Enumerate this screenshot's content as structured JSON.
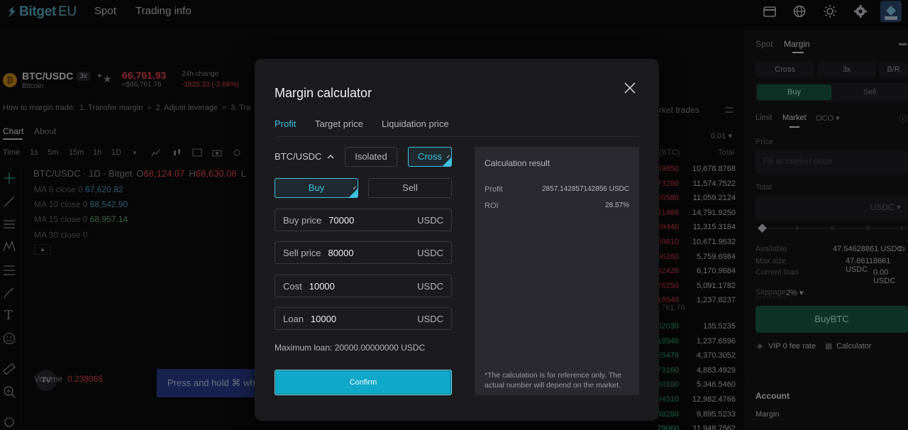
{
  "nav": {
    "brand": "Bitget",
    "brand_suffix": "EU",
    "links": [
      "Spot",
      "Trading info"
    ]
  },
  "ticker": {
    "pair": "BTC/USDC",
    "leverage": "3x",
    "coin_name": "Bitcoin",
    "coin_symbol": "₿",
    "price": "66,761.93",
    "price_fiat": "≈$66,761.76",
    "change_label": "24h change",
    "change_value": "-1825.33 (-2.66%)"
  },
  "guide": {
    "label": "How to margin trade:",
    "steps": [
      "1. Transfer margin",
      "2. Adjust leverage",
      "3. Tra"
    ]
  },
  "chart_tabs": [
    "Chart",
    "About"
  ],
  "timeframes": [
    "Time",
    "1s",
    "5m",
    "15m",
    "1h",
    "1D"
  ],
  "chart_header": {
    "title": "BTC/USDC · 1D · Bitget",
    "open_label": "O",
    "open": "68,124.07",
    "high_label": "H",
    "high": "68,630.08",
    "extra": "L"
  },
  "indicators": [
    {
      "label": "MA 5 close 0",
      "value": "67,620.82"
    },
    {
      "label": "MA 10 close 0",
      "value": "68,542.90"
    },
    {
      "label": "MA 15 close 0",
      "value": "68,957.14"
    },
    {
      "label": "MA 30 close 0",
      "value": ""
    }
  ],
  "volume": {
    "label": "Volume",
    "value": "0.238065"
  },
  "press_hold": "Press and hold ⌘ whi",
  "market_trades": {
    "title": "rket trades",
    "precision": "0.01",
    "col_qty": "(BTC)",
    "col_total": "Total",
    "asks": [
      {
        "p": "59850",
        "t": "10,678.8768"
      },
      {
        "p": "73280",
        "t": "11,574.7522"
      },
      {
        "p": "55580",
        "t": "11,059.2124"
      },
      {
        "p": "21480",
        "t": "14,791.9250"
      },
      {
        "p": "69440",
        "t": "11,315.3184"
      },
      {
        "p": "59810",
        "t": "10,671.9632"
      },
      {
        "p": "96260",
        "t": "5,759.6984"
      },
      {
        "p": "92420",
        "t": "6,170.9684"
      },
      {
        "p": "76250",
        "t": "5,091.1782"
      },
      {
        "p": "18540",
        "t": "1,237.8237"
      }
    ],
    "mid": ",761.76",
    "bids": [
      {
        "p": "02030",
        "t": "135.5235"
      },
      {
        "p": "18540",
        "t": "1,237.6596"
      },
      {
        "p": "65470",
        "t": "4,370.3052"
      },
      {
        "p": "73160",
        "t": "4,883.4929"
      },
      {
        "p": "80100",
        "t": "5,346.5460"
      },
      {
        "p": "94510",
        "t": "12,982.4766"
      },
      {
        "p": "48260",
        "t": "9,895.5233"
      },
      {
        "p": "79060",
        "t": "11,948.7562"
      }
    ]
  },
  "right_panel": {
    "tabs": [
      "Spot",
      "Margin"
    ],
    "mode_buttons": [
      "Cross",
      "3x",
      "B/R"
    ],
    "side": {
      "buy": "Buy",
      "sell": "Sell"
    },
    "order_types": [
      "Limit",
      "Market",
      "OCO ▾"
    ],
    "price_label": "Price",
    "price_placeholder": "Fill at market price",
    "total_label": "Total",
    "total_unit": "USDC ▾",
    "available_label": "Available",
    "available_value": "47.54628861 USDC",
    "maxsize_label": "Max size",
    "maxsize_value": "47.86118861 USDC",
    "loan_label": "Current loan",
    "loan_value": "0.00 USDC",
    "slippage_label": "Slippage",
    "slippage_value": "2% ▾",
    "buy_button": "BuyBTC",
    "vip": "VIP 0 fee rate",
    "calculator": "Calculator",
    "account_title": "Account",
    "account_sub": "Margin"
  },
  "modal": {
    "title": "Margin calculator",
    "tabs": [
      "Profit",
      "Target price",
      "Liquidation price"
    ],
    "pair": "BTC/USDC",
    "mode": {
      "isolated": "Isolated",
      "cross": "Cross"
    },
    "side": {
      "buy": "Buy",
      "sell": "Sell"
    },
    "fields": [
      {
        "label": "Buy price",
        "value": "70000",
        "unit": "USDC"
      },
      {
        "label": "Sell price",
        "value": "80000",
        "unit": "USDC"
      },
      {
        "label": "Cost",
        "value": "10000",
        "unit": "USDC"
      },
      {
        "label": "Loan",
        "value": "10000",
        "unit": "USDC"
      }
    ],
    "max_loan": "Maximum loan: 20000.00000000 USDC",
    "confirm": "Confirm",
    "result": {
      "title": "Calculation result",
      "profit_label": "Profit",
      "profit_value": "2857.142857142856 USDC",
      "roi_label": "ROI",
      "roi_value": "28.57%",
      "note": "*The calculation is for reference only. The actual number will depend on the market."
    }
  },
  "colors": {
    "accent": "#3fc0df",
    "up": "#2fbd7b",
    "down": "#f0464f",
    "confirm": "#0fa8c8"
  }
}
